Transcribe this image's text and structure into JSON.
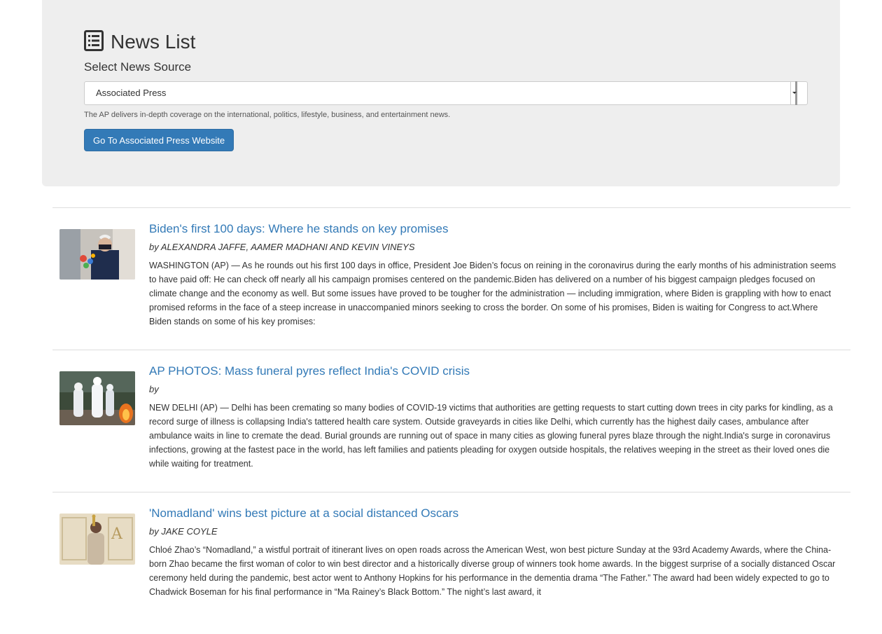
{
  "header": {
    "title": "News List",
    "icon": "list-alt-icon"
  },
  "source_select": {
    "label": "Select News Source",
    "selected": "Associated Press",
    "help_text": "The AP delivers in-depth coverage on the international, politics, lifestyle, business, and entertainment news."
  },
  "go_button": {
    "label": "Go To Associated Press Website",
    "color": "#337ab7"
  },
  "articles": [
    {
      "headline": "Biden's first 100 days: Where he stands on key promises",
      "byline": "by ALEXANDRA JAFFE, AAMER MADHANI AND KEVIN VINEYS",
      "summary": "WASHINGTON (AP) — As he rounds out his first 100 days in office, President Joe Biden’s focus on reining in the coronavirus during the early months of his administration seems to have paid off: He can check off nearly all his campaign promises centered on the pandemic.Biden has delivered on a number of his biggest campaign pledges focused on climate change and the economy as well. But some issues have proved to be tougher for the administration — including immigration, where Biden is grappling with how to enact promised reforms in the face of a steep increase in unaccompanied minors seeking to cross the border. On some of his promises, Biden is waiting for Congress to act.Where Biden stands on some of his key promises:"
    },
    {
      "headline": "AP PHOTOS: Mass funeral pyres reflect India's COVID crisis",
      "byline": "by",
      "summary": "NEW DELHI (AP) — Delhi has been cremating so many bodies of COVID-19 victims that authorities are getting requests to start cutting down trees in city parks for kindling, as a record surge of illness is collapsing India's tattered health care system. Outside graveyards in cities like Delhi, which currently has the highest daily cases, ambulance after ambulance waits in line to cremate the dead. Burial grounds are running out of space in many cities as glowing funeral pyres blaze through the night.India's surge in coronavirus infections, growing at the fastest pace in the world, has left families and patients pleading for oxygen outside hospitals, the relatives weeping in the street as their loved ones die while waiting for treatment."
    },
    {
      "headline": "'Nomadland' wins best picture at a social distanced Oscars",
      "byline": "by JAKE COYLE",
      "summary": "Chloé Zhao’s “Nomadland,” a wistful portrait of itinerant lives on open roads across the American West, won best picture Sunday at the 93rd Academy Awards, where the China-born Zhao became the first woman of color to win best director and a historically diverse group of winners took home awards. In the biggest surprise of a socially distanced Oscar ceremony held during the pandemic, best actor went to Anthony Hopkins for his performance in the dementia drama “The Father.” The award had been widely expected to go to Chadwick Boseman for his final performance in “Ma Rainey’s Black Bottom.” The night’s last award, it"
    }
  ]
}
